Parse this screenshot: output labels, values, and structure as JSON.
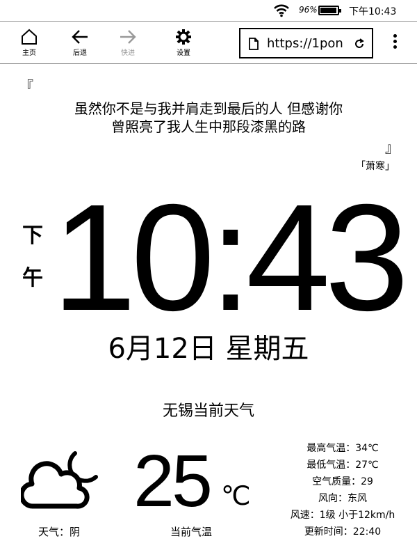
{
  "status": {
    "battery_percent": "96%",
    "battery_level": 0.96,
    "time": "下午10:43",
    "icons": [
      "wifi-icon",
      "battery-icon"
    ]
  },
  "toolbar": {
    "home_label": "主页",
    "back_label": "后退",
    "forward_label": "快进",
    "settings_label": "设置",
    "url": "https://1pon"
  },
  "quote": {
    "open_mark": "『",
    "line1": "虽然你不是与我并肩走到最后的人 但感谢你",
    "line2": "曾照亮了我人生中那段漆黑的路",
    "close_mark": "』",
    "author": "「萧寒」"
  },
  "clock": {
    "ampm_1": "下",
    "ampm_2": "午",
    "time": "10:43",
    "date": "6月12日 星期五"
  },
  "weather": {
    "city": "无锡当前天气",
    "condition": "天气：阴",
    "temperature": "25",
    "unit": "℃",
    "temperature_label": "当前气温",
    "details": [
      "最高气温：34℃",
      "最低气温：27℃",
      "空气质量：29",
      "风向：东风",
      "风速：1级 小于12km/h",
      "更新时间：22:40"
    ],
    "icon": "cloudy-night-icon"
  }
}
